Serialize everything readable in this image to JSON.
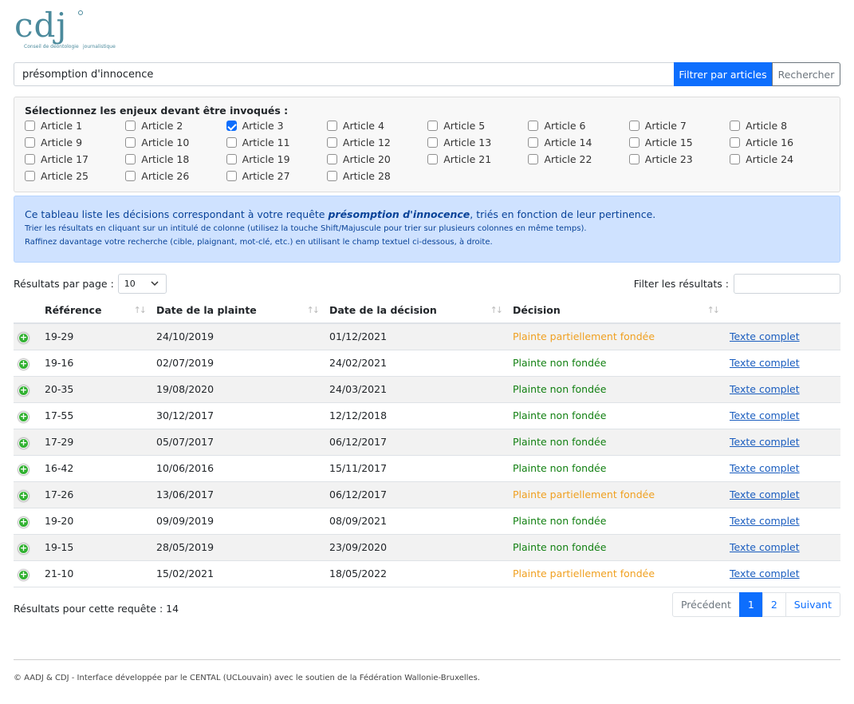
{
  "logo": {
    "letters": "cdj",
    "sub1": "Conseil de déontologie",
    "sub2": "journalistique"
  },
  "search": {
    "value": "présomption d'innocence",
    "filter_btn": "Filtrer par articles",
    "search_btn": "Rechercher"
  },
  "articles": {
    "title": "Sélectionnez les enjeux devant être invoqués :",
    "items": [
      {
        "label": "Article 1",
        "checked": false
      },
      {
        "label": "Article 2",
        "checked": false
      },
      {
        "label": "Article 3",
        "checked": true
      },
      {
        "label": "Article 4",
        "checked": false
      },
      {
        "label": "Article 5",
        "checked": false
      },
      {
        "label": "Article 6",
        "checked": false
      },
      {
        "label": "Article 7",
        "checked": false
      },
      {
        "label": "Article 8",
        "checked": false
      },
      {
        "label": "Article 9",
        "checked": false
      },
      {
        "label": "Article 10",
        "checked": false
      },
      {
        "label": "Article 11",
        "checked": false
      },
      {
        "label": "Article 12",
        "checked": false
      },
      {
        "label": "Article 13",
        "checked": false
      },
      {
        "label": "Article 14",
        "checked": false
      },
      {
        "label": "Article 15",
        "checked": false
      },
      {
        "label": "Article 16",
        "checked": false
      },
      {
        "label": "Article 17",
        "checked": false
      },
      {
        "label": "Article 18",
        "checked": false
      },
      {
        "label": "Article 19",
        "checked": false
      },
      {
        "label": "Article 20",
        "checked": false
      },
      {
        "label": "Article 21",
        "checked": false
      },
      {
        "label": "Article 22",
        "checked": false
      },
      {
        "label": "Article 23",
        "checked": false
      },
      {
        "label": "Article 24",
        "checked": false
      },
      {
        "label": "Article 25",
        "checked": false
      },
      {
        "label": "Article 26",
        "checked": false
      },
      {
        "label": "Article 27",
        "checked": false
      },
      {
        "label": "Article 28",
        "checked": false
      }
    ]
  },
  "info": {
    "line1_pre": "Ce tableau liste les décisions correspondant à votre requête ",
    "line1_query": "présomption d'innocence",
    "line1_post": ", triés en fonction de leur pertinence.",
    "line2": "Trier les résultats en cliquant sur un intitulé de colonne (utilisez la touche Shift/Majuscule pour trier sur plusieurs colonnes en même temps).",
    "line3": "Raffinez davantage votre recherche (cible, plaignant, mot-clé, etc.) en utilisant le champ textuel ci-dessous, à droite."
  },
  "controls": {
    "per_page_label": "Résultats par page :",
    "per_page_value": "10",
    "filter_label": "Filter les résultats :"
  },
  "table": {
    "headers": [
      "Référence",
      "Date de la plainte",
      "Date de la décision",
      "Décision"
    ],
    "rows": [
      {
        "ref": "19-29",
        "plainte": "24/10/2019",
        "decision_date": "01/12/2021",
        "decision": "Plainte partiellement fondée",
        "kind": "partial",
        "link": "Texte complet"
      },
      {
        "ref": "19-16",
        "plainte": "02/07/2019",
        "decision_date": "24/02/2021",
        "decision": "Plainte non fondée",
        "kind": "non",
        "link": "Texte complet"
      },
      {
        "ref": "20-35",
        "plainte": "19/08/2020",
        "decision_date": "24/03/2021",
        "decision": "Plainte non fondée",
        "kind": "non",
        "link": "Texte complet"
      },
      {
        "ref": "17-55",
        "plainte": "30/12/2017",
        "decision_date": "12/12/2018",
        "decision": "Plainte non fondée",
        "kind": "non",
        "link": "Texte complet"
      },
      {
        "ref": "17-29",
        "plainte": "05/07/2017",
        "decision_date": "06/12/2017",
        "decision": "Plainte non fondée",
        "kind": "non",
        "link": "Texte complet"
      },
      {
        "ref": "16-42",
        "plainte": "10/06/2016",
        "decision_date": "15/11/2017",
        "decision": "Plainte non fondée",
        "kind": "non",
        "link": "Texte complet"
      },
      {
        "ref": "17-26",
        "plainte": "13/06/2017",
        "decision_date": "06/12/2017",
        "decision": "Plainte partiellement fondée",
        "kind": "partial",
        "link": "Texte complet"
      },
      {
        "ref": "19-20",
        "plainte": "09/09/2019",
        "decision_date": "08/09/2021",
        "decision": "Plainte non fondée",
        "kind": "non",
        "link": "Texte complet"
      },
      {
        "ref": "19-15",
        "plainte": "28/05/2019",
        "decision_date": "23/09/2020",
        "decision": "Plainte non fondée",
        "kind": "non",
        "link": "Texte complet"
      },
      {
        "ref": "21-10",
        "plainte": "15/02/2021",
        "decision_date": "18/05/2022",
        "decision": "Plainte partiellement fondée",
        "kind": "partial",
        "link": "Texte complet"
      }
    ]
  },
  "results_count": "Résultats pour cette requête : 14",
  "pagination": {
    "prev": "Précédent",
    "pages": [
      "1",
      "2"
    ],
    "next": "Suivant"
  },
  "footer": "© AADJ & CDJ - Interface développée par le CENTAL (UCLouvain) avec le soutien de la Fédération Wallonie-Bruxelles."
}
